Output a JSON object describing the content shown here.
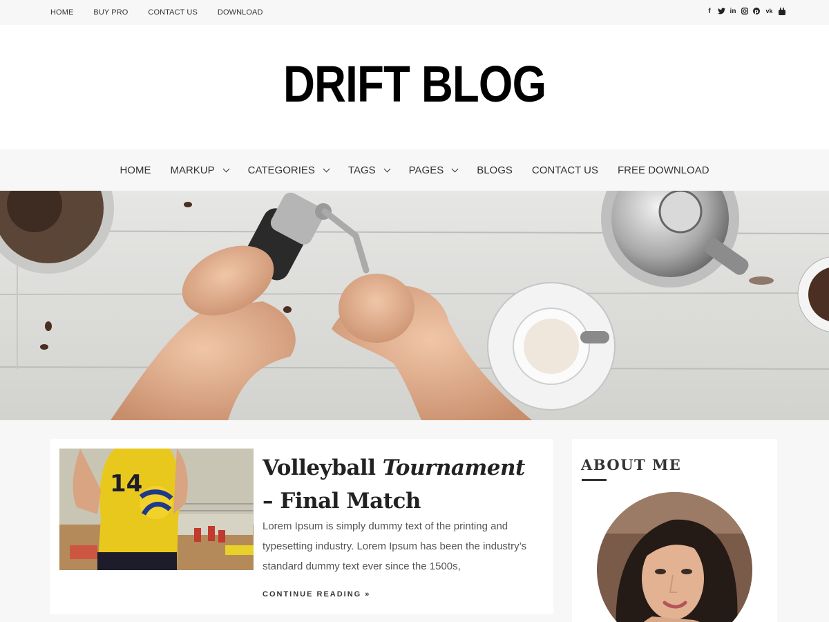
{
  "topnav": {
    "items": [
      "HOME",
      "BUY PRO",
      "CONTACT US",
      "DOWNLOAD"
    ]
  },
  "social": {
    "icons": [
      "facebook-icon",
      "twitter-icon",
      "linkedin-icon",
      "instagram-icon",
      "pinterest-icon",
      "vk-icon",
      "youtube-icon"
    ]
  },
  "site": {
    "title": "DRIFT BLOG"
  },
  "mainnav": {
    "items": [
      {
        "label": "HOME"
      },
      {
        "label": "MARKUP"
      },
      {
        "label": "CATEGORIES"
      },
      {
        "label": "TAGS"
      },
      {
        "label": "PAGES"
      },
      {
        "label": "BLOGS"
      },
      {
        "label": "CONTACT US"
      },
      {
        "label": "FREE DOWNLOAD"
      }
    ]
  },
  "post": {
    "title_part1": "Volleyball ",
    "title_italic": "Tournament",
    "title_part2": " – Final Match",
    "excerpt": "Lorem Ipsum is simply dummy text of the printing and typesetting industry. Lorem Ipsum has been the industry’s standard dummy text ever since the 1500s,",
    "continue_label": "CONTINUE READING »",
    "jersey_number": "14"
  },
  "sidebar": {
    "widget_title": "ABOUT ME"
  }
}
